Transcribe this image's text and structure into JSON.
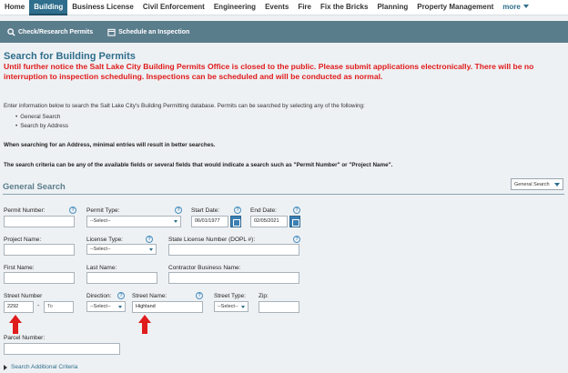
{
  "nav": {
    "items": [
      {
        "label": "Home",
        "active": false
      },
      {
        "label": "Building",
        "active": true
      },
      {
        "label": "Business License",
        "active": false
      },
      {
        "label": "Civil Enforcement",
        "active": false
      },
      {
        "label": "Engineering",
        "active": false
      },
      {
        "label": "Events",
        "active": false
      },
      {
        "label": "Fire",
        "active": false
      },
      {
        "label": "Fix the Bricks",
        "active": false
      },
      {
        "label": "Planning",
        "active": false
      },
      {
        "label": "Property Management",
        "active": false
      }
    ],
    "more_label": "more"
  },
  "subnav": {
    "check_research": "Check/Research Permits",
    "schedule": "Schedule an Inspection"
  },
  "page": {
    "title": "Search for Building Permits",
    "notice": "Until further notice the Salt Lake City Building Permits Office is closed to the public.  Please submit applications electronically. There will be no interruption to inspection scheduling.  Inspections can be scheduled and will be conducted as normal.",
    "intro": "Enter information below to search the Salt Lake City's Building Permitting database. Permits can be searched by selecting any of the following:",
    "bullets": [
      "General Search",
      "Search by Address"
    ],
    "hint_address": "When searching for an Address, minimal entries will result in better searches.",
    "hint_criteria": "The search criteria can be any of the available fields or several fields that would indicate a search such as \"Permit Number\" or \"Project Name\"."
  },
  "section": {
    "title": "General Search",
    "search_type": "General Search"
  },
  "form": {
    "permit_number_label": "Permit Number:",
    "permit_type_label": "Permit Type:",
    "permit_type_value": "--Select--",
    "start_date_label": "Start Date:",
    "start_date_value": "06/01/1977",
    "end_date_label": "End Date:",
    "end_date_value": "02/05/2021",
    "project_name_label": "Project Name:",
    "license_type_label": "License Type:",
    "license_type_value": "--Select--",
    "state_license_label": "State License Number (DOPL #):",
    "first_name_label": "First Name:",
    "last_name_label": "Last Name:",
    "contractor_label": "Contractor Business Name:",
    "street_number_label": "Street Number",
    "street_number_from": "2292",
    "street_number_to_placeholder": "To",
    "direction_label": "Direction:",
    "direction_value": "--Select--",
    "street_name_label": "Street Name:",
    "street_name_value": "Highland",
    "street_type_label": "Street Type:",
    "street_type_value": "--Select--",
    "zip_label": "Zip:",
    "parcel_label": "Parcel Number:",
    "help_glyph": "?"
  },
  "advanced_link": "Search Additional Criteria",
  "colors": {
    "accent": "#2f6e8c",
    "notice_red": "#e01b1b",
    "toolbar": "#5a7d8c"
  }
}
